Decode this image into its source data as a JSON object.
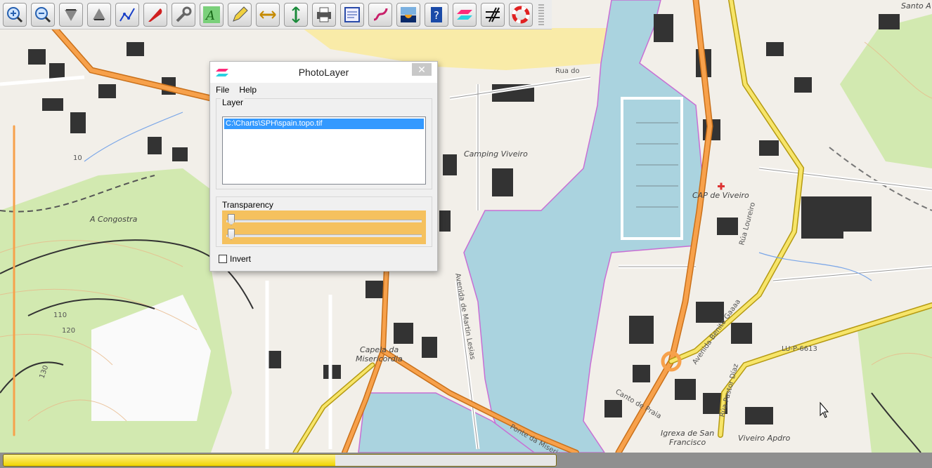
{
  "map": {
    "labels": {
      "camping": "Camping Viveiro",
      "congostra": "A Congostra",
      "cap": "CAP de Viveiro",
      "capela": "Capela da",
      "capela2": "Misericordia",
      "igrexa": "Igrexa de San",
      "igrexa2": "Francisco",
      "viveiro_apdro": "Viveiro Apdro",
      "santo": "Santo A",
      "rua_do": "Rua do",
      "avenida_mendez": "Avenida de Martin Lesias",
      "avenida_benito": "Avenida Benito Gaaaa",
      "lu": "LU-P-6613",
      "rua_loureiro": "Rúa Loureiro",
      "rua_pastor": "Rúa Pastor Díaz",
      "porto_misericordia": "Ponte da Misericordia",
      "canto": "Canto de Praia",
      "c10": "10",
      "c110": "110",
      "c120": "120",
      "c130": "130"
    }
  },
  "toolbar": {
    "tools": [
      {
        "name": "zoom-in-icon"
      },
      {
        "name": "zoom-out-icon"
      },
      {
        "name": "tides-down-icon"
      },
      {
        "name": "tides-up-icon"
      },
      {
        "name": "route-icon"
      },
      {
        "name": "boat-icon"
      },
      {
        "name": "wrench-icon"
      },
      {
        "name": "text-icon"
      },
      {
        "name": "pencil-icon"
      },
      {
        "name": "measure-icon"
      },
      {
        "name": "vertical-measure-icon"
      },
      {
        "name": "print-icon"
      },
      {
        "name": "logbook-icon"
      },
      {
        "name": "track-icon"
      },
      {
        "name": "photo-layer-icon"
      },
      {
        "name": "help-icon"
      },
      {
        "name": "layer-icon"
      },
      {
        "name": "vector-icon"
      },
      {
        "name": "lifebuoy-icon"
      }
    ]
  },
  "dialog": {
    "title": "PhotoLayer",
    "close": "✕",
    "menu": {
      "file": "File",
      "help": "Help"
    },
    "layer_group": "Layer",
    "layer_item": "C:\\Charts\\SPH\\spain.topo.tif",
    "transparency_group": "Transparency",
    "invert_label": "Invert",
    "invert_checked": false,
    "slider1_value": 0,
    "slider2_value": 0
  },
  "status": {
    "progress_fraction": 0.6,
    "colors": {
      "fill": "#f0d400",
      "bar": "#8f8f8f"
    }
  }
}
